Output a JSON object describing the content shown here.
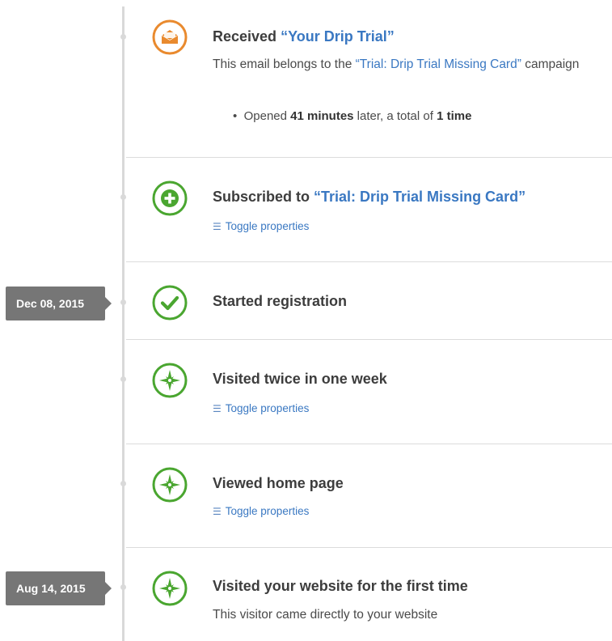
{
  "colors": {
    "accent_link": "#3a78c2",
    "green": "#4aa630",
    "orange": "#e98a2e",
    "badge_bg": "#767676",
    "line": "#d9d9d9"
  },
  "date_badges": [
    "Dec 08, 2015",
    "Aug 14, 2015"
  ],
  "events": [
    {
      "icon": "envelope-open-icon",
      "title_prefix": "Received ",
      "title_link": "“Your Drip Trial”",
      "desc_prefix": "This email belongs to the ",
      "desc_link": "“Trial: Drip Trial Missing Card”",
      "desc_suffix": " campaign",
      "bullet": {
        "prefix": "Opened ",
        "bold1": "41 minutes",
        "middle": " later, a total of ",
        "bold2": "1 time"
      }
    },
    {
      "icon": "plus-circle-icon",
      "title_prefix": "Subscribed to ",
      "title_link": "“Trial: Drip Trial Missing Card”",
      "toggle": "Toggle properties"
    },
    {
      "icon": "checkmark-circle-icon",
      "title": "Started registration"
    },
    {
      "icon": "compass-icon",
      "title": "Visited twice in one week",
      "toggle": "Toggle properties"
    },
    {
      "icon": "compass-icon",
      "title": "Viewed home page",
      "toggle": "Toggle properties"
    },
    {
      "icon": "compass-icon",
      "title": "Visited your website for the first time",
      "desc": "This visitor came directly to your website"
    }
  ]
}
